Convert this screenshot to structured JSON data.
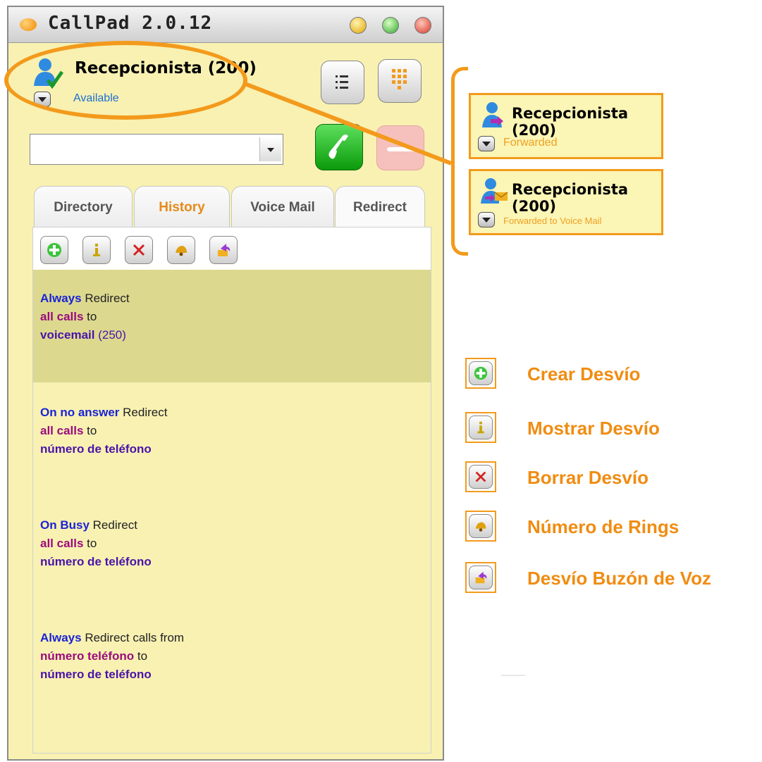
{
  "window": {
    "title": "CallPad 2.0.12"
  },
  "user": {
    "name": "Recepcionista (200)",
    "status": "Available"
  },
  "dial": {
    "value": "",
    "placeholder": ""
  },
  "tabs": [
    {
      "label": "Directory"
    },
    {
      "label": "History"
    },
    {
      "label": "Voice Mail"
    },
    {
      "label": "Redirect"
    }
  ],
  "rules": [
    {
      "when": "Always",
      "l1": " Redirect",
      "who": "all calls",
      "l2": " to",
      "target": "voicemail",
      "suffix": " (250)"
    },
    {
      "when": "On no answer",
      "l1": " Redirect",
      "who": "all calls",
      "l2": " to",
      "target": "número de teléfono",
      "suffix": ""
    },
    {
      "when": "On Busy",
      "l1": " Redirect",
      "who": "all calls",
      "l2": " to",
      "target": "número de teléfono",
      "suffix": ""
    },
    {
      "when": "Always",
      "l1": " Redirect calls from",
      "who": "número teléfono",
      "l2": " to",
      "target": "número de teléfono",
      "suffix": ""
    }
  ],
  "status_examples": [
    {
      "name": "Recepcionista (200)",
      "status": "Forwarded"
    },
    {
      "name": "Recepcionista (200)",
      "status": "Forwarded to Voice Mail"
    }
  ],
  "legend": [
    {
      "label": "Crear Desvío",
      "icon": "plus-icon"
    },
    {
      "label": "Mostrar Desvío",
      "icon": "info-icon"
    },
    {
      "label": "Borrar Desvío",
      "icon": "delete-icon"
    },
    {
      "label": "Número de Rings",
      "icon": "bell-icon"
    },
    {
      "label": "Desvío Buzón de Voz",
      "icon": "voicemail-forward-icon"
    }
  ],
  "colors": {
    "accent": "#f39a1c",
    "panel": "#f8f1b2",
    "highlight": "#dcd98f"
  }
}
